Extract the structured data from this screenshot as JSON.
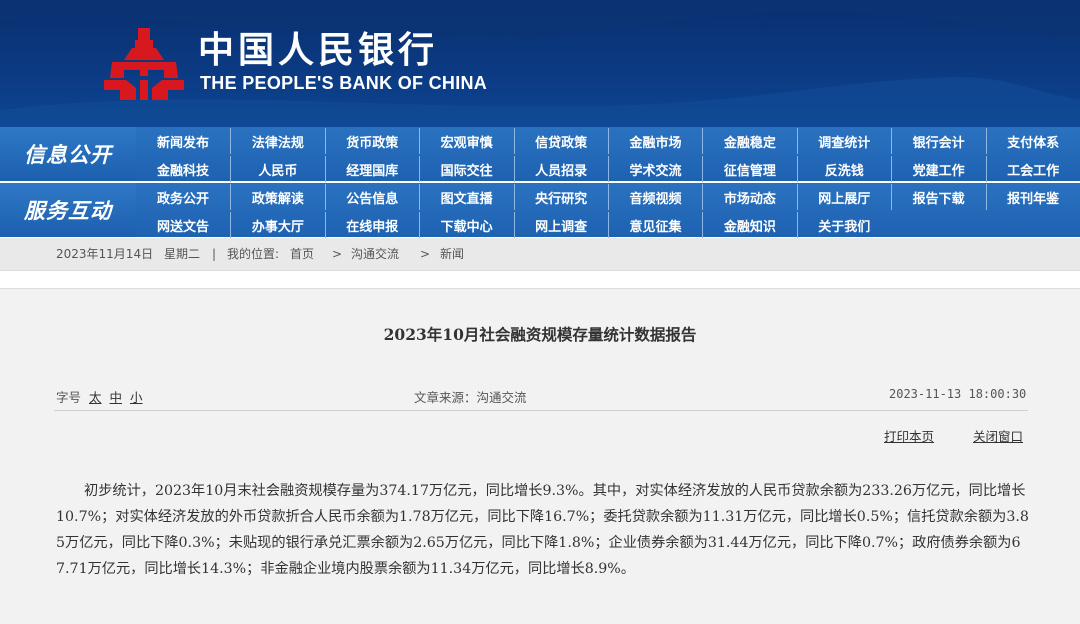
{
  "header": {
    "logo_cn": "中国人民银行",
    "logo_en": "THE PEOPLE'S BANK OF CHINA",
    "colors": {
      "primary": "#0b3a82",
      "logo_red": "#d7191f"
    }
  },
  "nav": {
    "section1_label": "信息公开",
    "section2_label": "服务互动",
    "section1_items": [
      "新闻发布",
      "法律法规",
      "货币政策",
      "宏观审慎",
      "信贷政策",
      "金融市场",
      "金融稳定",
      "调查统计",
      "银行会计",
      "支付体系",
      "金融科技",
      "人民币",
      "经理国库",
      "国际交往",
      "人员招录",
      "学术交流",
      "征信管理",
      "反洗钱",
      "党建工作",
      "工会工作"
    ],
    "section2_items": [
      "政务公开",
      "政策解读",
      "公告信息",
      "图文直播",
      "央行研究",
      "音频视频",
      "市场动态",
      "网上展厅",
      "报告下载",
      "报刊年鉴",
      "网送文告",
      "办事大厅",
      "在线申报",
      "下载中心",
      "网上调查",
      "意见征集",
      "金融知识",
      "关于我们"
    ]
  },
  "breadcrumb": {
    "date": "2023年11月14日",
    "weekday": "星期二",
    "location_label": "我的位置:",
    "home": "首页",
    "level1": "沟通交流",
    "level2": "新闻",
    "sep1": "|",
    "arrow": ">"
  },
  "article": {
    "title": "2023年10月社会融资规模存量统计数据报告",
    "font_size_label": "字号",
    "font_size_large": "太",
    "font_size_medium": "中",
    "font_size_small": "小",
    "source": "文章来源：沟通交流",
    "timestamp": "2023-11-13 18:00:30",
    "print_label": "打印本页",
    "close_label": "关闭窗口",
    "body": "初步统计，2023年10月末社会融资规模存量为374.17万亿元，同比增长9.3%。其中，对实体经济发放的人民币贷款余额为233.26万亿元，同比增长10.7%；对实体经济发放的外币贷款折合人民币余额为1.78万亿元，同比下降16.7%；委托贷款余额为11.31万亿元，同比增长0.5%；信托贷款余额为3.85万亿元，同比下降0.3%；未贴现的银行承兑汇票余额为2.65万亿元，同比下降1.8%；企业债券余额为31.44万亿元，同比下降0.7%；政府债券余额为67.71万亿元，同比增长14.3%；非金融企业境内股票余额为11.34万亿元，同比增长8.9%。"
  }
}
